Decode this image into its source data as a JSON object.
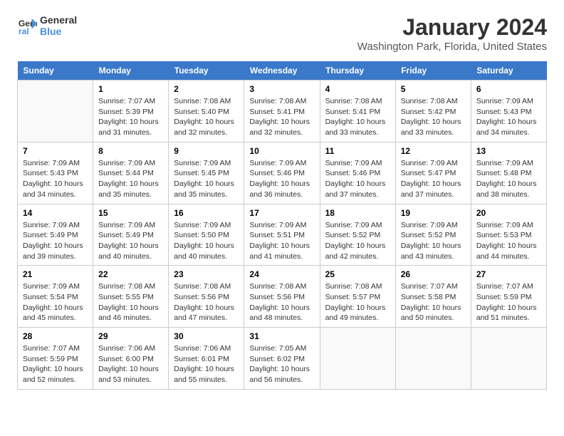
{
  "logo": {
    "line1": "General",
    "line2": "Blue"
  },
  "title": "January 2024",
  "subtitle": "Washington Park, Florida, United States",
  "header": {
    "days": [
      "Sunday",
      "Monday",
      "Tuesday",
      "Wednesday",
      "Thursday",
      "Friday",
      "Saturday"
    ]
  },
  "weeks": [
    {
      "cells": [
        {
          "day": "",
          "content": ""
        },
        {
          "day": "1",
          "content": "Sunrise: 7:07 AM\nSunset: 5:39 PM\nDaylight: 10 hours\nand 31 minutes."
        },
        {
          "day": "2",
          "content": "Sunrise: 7:08 AM\nSunset: 5:40 PM\nDaylight: 10 hours\nand 32 minutes."
        },
        {
          "day": "3",
          "content": "Sunrise: 7:08 AM\nSunset: 5:41 PM\nDaylight: 10 hours\nand 32 minutes."
        },
        {
          "day": "4",
          "content": "Sunrise: 7:08 AM\nSunset: 5:41 PM\nDaylight: 10 hours\nand 33 minutes."
        },
        {
          "day": "5",
          "content": "Sunrise: 7:08 AM\nSunset: 5:42 PM\nDaylight: 10 hours\nand 33 minutes."
        },
        {
          "day": "6",
          "content": "Sunrise: 7:09 AM\nSunset: 5:43 PM\nDaylight: 10 hours\nand 34 minutes."
        }
      ]
    },
    {
      "cells": [
        {
          "day": "7",
          "content": "Sunrise: 7:09 AM\nSunset: 5:43 PM\nDaylight: 10 hours\nand 34 minutes."
        },
        {
          "day": "8",
          "content": "Sunrise: 7:09 AM\nSunset: 5:44 PM\nDaylight: 10 hours\nand 35 minutes."
        },
        {
          "day": "9",
          "content": "Sunrise: 7:09 AM\nSunset: 5:45 PM\nDaylight: 10 hours\nand 35 minutes."
        },
        {
          "day": "10",
          "content": "Sunrise: 7:09 AM\nSunset: 5:46 PM\nDaylight: 10 hours\nand 36 minutes."
        },
        {
          "day": "11",
          "content": "Sunrise: 7:09 AM\nSunset: 5:46 PM\nDaylight: 10 hours\nand 37 minutes."
        },
        {
          "day": "12",
          "content": "Sunrise: 7:09 AM\nSunset: 5:47 PM\nDaylight: 10 hours\nand 37 minutes."
        },
        {
          "day": "13",
          "content": "Sunrise: 7:09 AM\nSunset: 5:48 PM\nDaylight: 10 hours\nand 38 minutes."
        }
      ]
    },
    {
      "cells": [
        {
          "day": "14",
          "content": "Sunrise: 7:09 AM\nSunset: 5:49 PM\nDaylight: 10 hours\nand 39 minutes."
        },
        {
          "day": "15",
          "content": "Sunrise: 7:09 AM\nSunset: 5:49 PM\nDaylight: 10 hours\nand 40 minutes."
        },
        {
          "day": "16",
          "content": "Sunrise: 7:09 AM\nSunset: 5:50 PM\nDaylight: 10 hours\nand 40 minutes."
        },
        {
          "day": "17",
          "content": "Sunrise: 7:09 AM\nSunset: 5:51 PM\nDaylight: 10 hours\nand 41 minutes."
        },
        {
          "day": "18",
          "content": "Sunrise: 7:09 AM\nSunset: 5:52 PM\nDaylight: 10 hours\nand 42 minutes."
        },
        {
          "day": "19",
          "content": "Sunrise: 7:09 AM\nSunset: 5:52 PM\nDaylight: 10 hours\nand 43 minutes."
        },
        {
          "day": "20",
          "content": "Sunrise: 7:09 AM\nSunset: 5:53 PM\nDaylight: 10 hours\nand 44 minutes."
        }
      ]
    },
    {
      "cells": [
        {
          "day": "21",
          "content": "Sunrise: 7:09 AM\nSunset: 5:54 PM\nDaylight: 10 hours\nand 45 minutes."
        },
        {
          "day": "22",
          "content": "Sunrise: 7:08 AM\nSunset: 5:55 PM\nDaylight: 10 hours\nand 46 minutes."
        },
        {
          "day": "23",
          "content": "Sunrise: 7:08 AM\nSunset: 5:56 PM\nDaylight: 10 hours\nand 47 minutes."
        },
        {
          "day": "24",
          "content": "Sunrise: 7:08 AM\nSunset: 5:56 PM\nDaylight: 10 hours\nand 48 minutes."
        },
        {
          "day": "25",
          "content": "Sunrise: 7:08 AM\nSunset: 5:57 PM\nDaylight: 10 hours\nand 49 minutes."
        },
        {
          "day": "26",
          "content": "Sunrise: 7:07 AM\nSunset: 5:58 PM\nDaylight: 10 hours\nand 50 minutes."
        },
        {
          "day": "27",
          "content": "Sunrise: 7:07 AM\nSunset: 5:59 PM\nDaylight: 10 hours\nand 51 minutes."
        }
      ]
    },
    {
      "cells": [
        {
          "day": "28",
          "content": "Sunrise: 7:07 AM\nSunset: 5:59 PM\nDaylight: 10 hours\nand 52 minutes."
        },
        {
          "day": "29",
          "content": "Sunrise: 7:06 AM\nSunset: 6:00 PM\nDaylight: 10 hours\nand 53 minutes."
        },
        {
          "day": "30",
          "content": "Sunrise: 7:06 AM\nSunset: 6:01 PM\nDaylight: 10 hours\nand 55 minutes."
        },
        {
          "day": "31",
          "content": "Sunrise: 7:05 AM\nSunset: 6:02 PM\nDaylight: 10 hours\nand 56 minutes."
        },
        {
          "day": "",
          "content": ""
        },
        {
          "day": "",
          "content": ""
        },
        {
          "day": "",
          "content": ""
        }
      ]
    }
  ]
}
